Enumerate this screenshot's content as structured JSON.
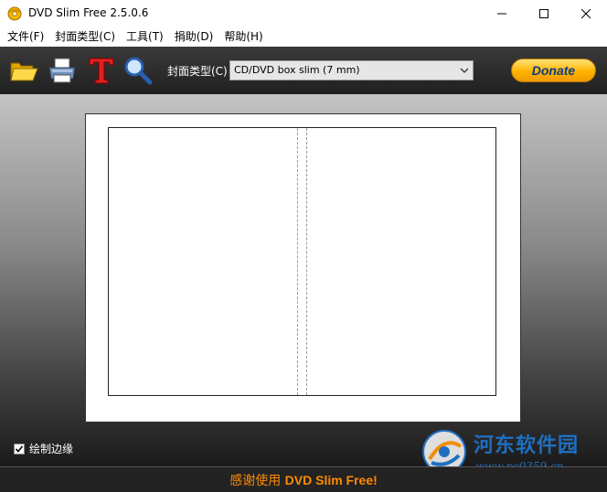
{
  "window": {
    "title": "DVD Slim Free 2.5.0.6"
  },
  "menu": {
    "items": [
      {
        "label": "文件(F)"
      },
      {
        "label": "封面类型(C)"
      },
      {
        "label": "工具(T)"
      },
      {
        "label": "捐助(D)"
      },
      {
        "label": "帮助(H)"
      }
    ]
  },
  "toolbar": {
    "icons": [
      "folder-open-icon",
      "printer-icon",
      "text-tool-icon",
      "zoom-icon"
    ],
    "cover_type_label": "封面类型(C)",
    "cover_type_value": "CD/DVD box slim (7 mm)",
    "donate_label": "Donate"
  },
  "options": {
    "draw_border_label": "绘制边缘",
    "draw_border_checked": true
  },
  "watermark": {
    "name": "河东软件园",
    "url": "www.pc0359.cn"
  },
  "status": {
    "prefix": "感谢使用 ",
    "product": "DVD Slim Free!"
  },
  "colors": {
    "status_text": "#ff8a00",
    "toolbar_bg": "#2b2b2b",
    "donate": "#ffb400",
    "watermark": "#1f6fc0"
  }
}
